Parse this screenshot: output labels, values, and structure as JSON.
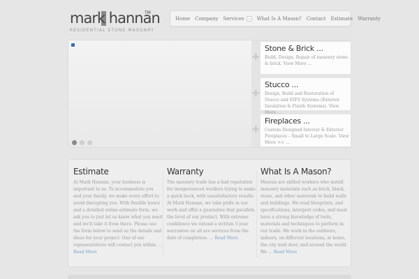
{
  "logo": {
    "name": "mark hannan",
    "trademark": "TM",
    "tagline": "RESIDENTIAL STONE MASONRY"
  },
  "nav": {
    "items": [
      "Home",
      "Company",
      "Services",
      "What Is A Mason?",
      "Contact",
      "Estimate",
      "Warranty"
    ],
    "dropdown_glyph": "⌄"
  },
  "slider": {
    "items": [
      {
        "title": "Stone & Brick ...",
        "desc": "Build, Design, Repair of masonry stone & brick. View More ..."
      },
      {
        "title": "Stucco ...",
        "desc": "Design, Build and Restoration of Stucco and EIFS Systems (Exterior Insulation & Finish Systems). View More ..."
      },
      {
        "title": "Fireplaces ...",
        "desc": "Custom Designed Interior & Exterior Fireplaces – Small to Large Scale. View More >> ..."
      }
    ],
    "active_dot": 0,
    "plus_glyph": "✚"
  },
  "columns": [
    {
      "title": "Estimate",
      "body": "At Mark Hannan, your business is important to us. To accommodate you and your family, we make every effort to avoid disrupting you. With flexible hours and a detailed online estimate form, we ask you to just let us know what you need and we'll take it from there. Please use the form below to send us the details and ideas for your project. One of our representatives will contact you within ... ",
      "link": "Read More"
    },
    {
      "title": "Warranty",
      "body": "The masonry trade has a bad reputation for inexperienced workers trying to make a quick buck, with unsatisfactory results. At Mark Hannan, we take pride in our work and offer a guarantee that parallels the level of our product. With extreme confidence we extend a written 5 year warrantee on all are services from the date of completion. ... ",
      "link": "Read More"
    },
    {
      "title": "What Is A Mason?",
      "body": "Masons are skilled workers who install masonry materials such as brick, block, stone, and other materials to build walls and buildings. We read blueprints, and specifications, interpret codes, and must have a strong knowledge of tools, materials and techniques to perform in our trade. We work in the outdoors, indoors, on different locations, at home, the city next door, and around the world. We ... ",
      "link": "Read More"
    }
  ],
  "colors": {
    "background": "#e6e6e6",
    "link": "#7d9fc6",
    "heading": "#333333"
  }
}
